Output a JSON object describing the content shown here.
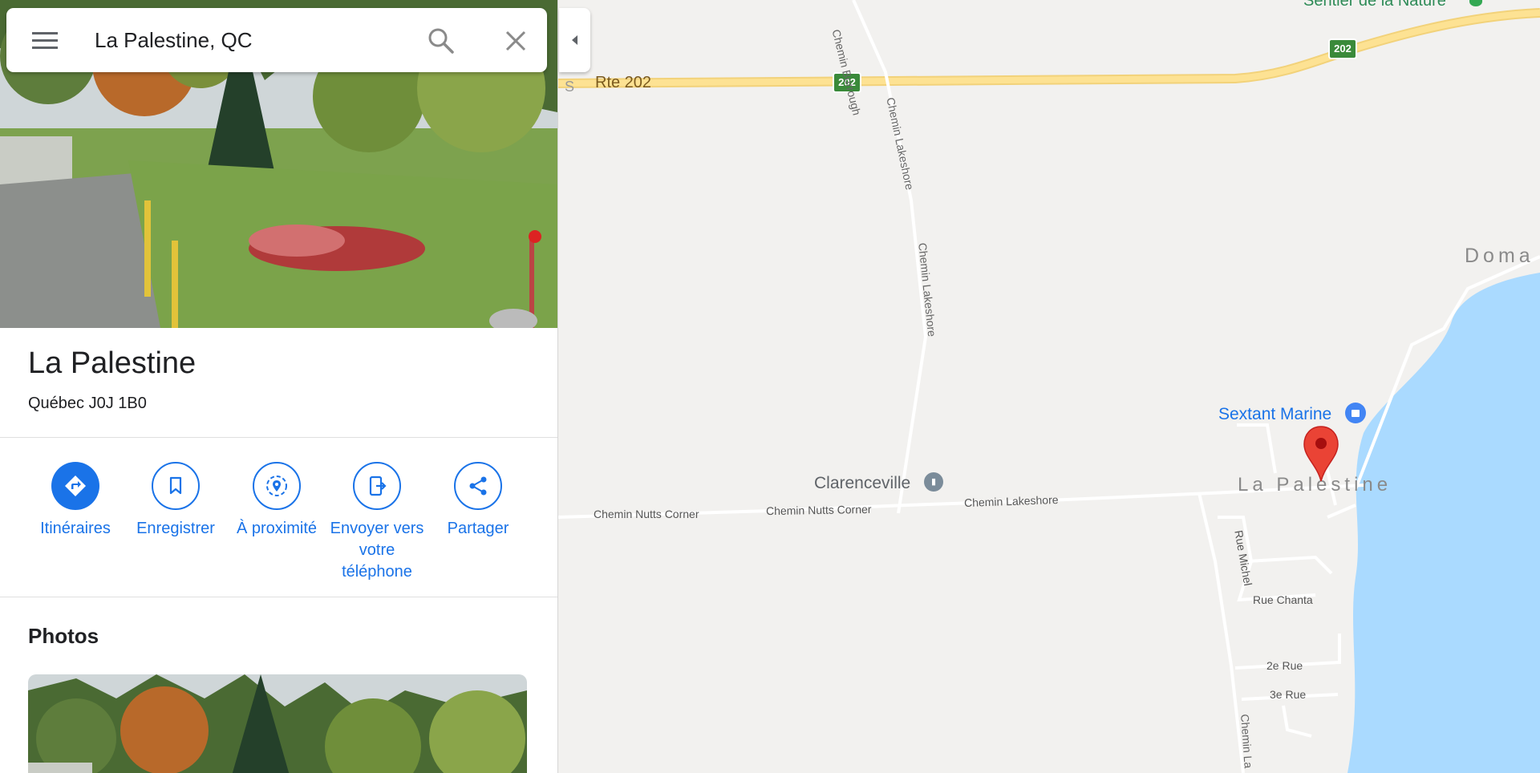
{
  "search": {
    "value": "La Palestine, QC",
    "icons": {
      "menu": "menu-icon",
      "search": "search-icon",
      "close": "close-icon"
    }
  },
  "place": {
    "title": "La Palestine",
    "address": "Québec J0J 1B0"
  },
  "actions": [
    {
      "label": "Itinéraires",
      "icon": "directions-icon"
    },
    {
      "label": "Enregistrer",
      "icon": "bookmark-icon"
    },
    {
      "label": "À proximité",
      "icon": "nearby-icon"
    },
    {
      "label": "Envoyer vers votre téléphone",
      "icon": "send-to-phone-icon"
    },
    {
      "label": "Partager",
      "icon": "share-icon"
    }
  ],
  "photos": {
    "heading": "Photos"
  },
  "map": {
    "labels": {
      "rte202": "Rte 202",
      "shield1": "202",
      "shield2": "202",
      "s": "S",
      "sentier": "Sentier de la Nature",
      "burrough": "Chemin Burrough",
      "lakeshore1": "Chemin Lakeshore",
      "lakeshore2": "Chemin Lakeshore",
      "lakeshore3": "Chemin Lakeshore",
      "lakeshore4": "Chemin La",
      "nutts1": "Chemin Nutts Corner",
      "nutts2": "Chemin Nutts Corner",
      "clarenceville": "Clarenceville",
      "palestine": "La Palestine",
      "sextant": "Sextant Marine",
      "doma": "Doma",
      "rueMichel": "Rue Michel",
      "rueChanta": "Rue Chanta",
      "rue2": "2e Rue",
      "rue3": "3e Rue"
    },
    "colors": {
      "land": "#f2f1ef",
      "water": "#aadaff",
      "highway": "#fde293",
      "pin": "#ea4335",
      "accent": "#1a73e8"
    }
  }
}
